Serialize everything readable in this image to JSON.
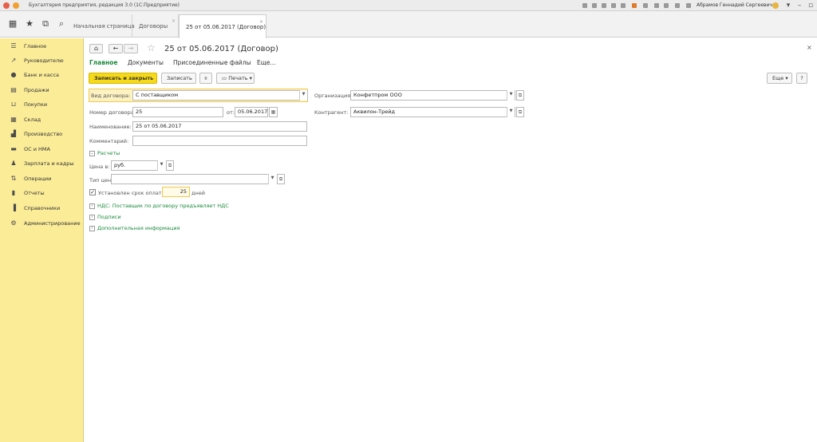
{
  "window": {
    "title": "Бухгалтерия предприятия, редакция 3.0  (1С:Предприятие)",
    "user": "Абрамов Геннадий Сергеевич"
  },
  "tabs": [
    {
      "label": "Начальная страница"
    },
    {
      "label": "Договоры"
    },
    {
      "label": "25 от 05.06.2017 (Договор)"
    }
  ],
  "sidebar": {
    "items": [
      {
        "label": "Главное",
        "icon": "menu-icon"
      },
      {
        "label": "Руководителю",
        "icon": "chart-line-icon"
      },
      {
        "label": "Банк и касса",
        "icon": "bank-icon"
      },
      {
        "label": "Продажи",
        "icon": "sales-icon"
      },
      {
        "label": "Покупки",
        "icon": "cart-icon"
      },
      {
        "label": "Склад",
        "icon": "warehouse-icon"
      },
      {
        "label": "Производство",
        "icon": "factory-icon"
      },
      {
        "label": "ОС и НМА",
        "icon": "truck-icon"
      },
      {
        "label": "Зарплата и кадры",
        "icon": "person-icon"
      },
      {
        "label": "Операции",
        "icon": "operations-icon"
      },
      {
        "label": "Отчеты",
        "icon": "bar-chart-icon"
      },
      {
        "label": "Справочники",
        "icon": "book-icon"
      },
      {
        "label": "Администрирование",
        "icon": "gear-icon"
      }
    ]
  },
  "form": {
    "title": "25 от 05.06.2017 (Договор)",
    "form_tabs": [
      "Главное",
      "Документы",
      "Присоединенные файлы",
      "Еще..."
    ],
    "toolbar": {
      "save_close": "Записать и закрыть",
      "save": "Записать",
      "print": "Печать",
      "more": "Еще",
      "help": "?"
    },
    "fields": {
      "contract_type_label": "Вид договора:",
      "contract_type_value": "С поставщиком",
      "organization_label": "Организация:",
      "organization_value": "Конфетпром ООО",
      "number_label": "Номер договора:",
      "number_value": "25",
      "date_label": "от:",
      "date_value": "05.06.2017",
      "counterparty_label": "Контрагент:",
      "counterparty_value": "Аквилон-Трейд",
      "name_label": "Наименование:",
      "name_value": "25 от 05.06.2017",
      "comment_label": "Комментарий:",
      "comment_value": ""
    },
    "settlements": {
      "group_label": "Расчеты",
      "price_label": "Цена в:",
      "price_value": "руб.",
      "price_type_label": "Тип цен:",
      "price_type_value": "",
      "payment_term_label": "Установлен срок оплаты",
      "payment_term_checked": true,
      "payment_term_value": "25",
      "payment_term_unit": "дней"
    },
    "collapsed_groups": [
      "НДС: Поставщик по договору предъявляет НДС",
      "Подписи",
      "Дополнительная информация"
    ]
  }
}
